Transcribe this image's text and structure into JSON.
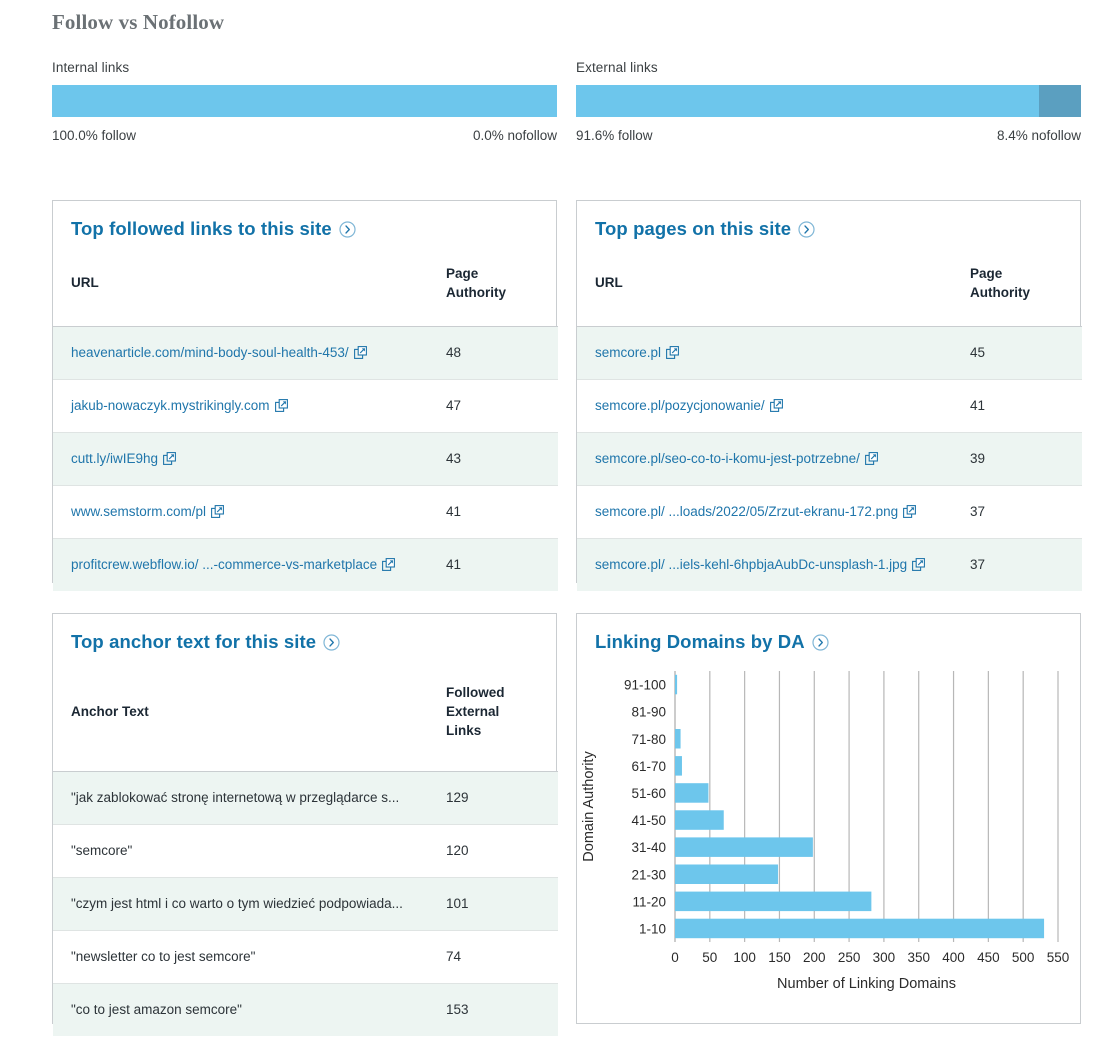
{
  "section": {
    "title": "Follow vs Nofollow"
  },
  "colors": {
    "follow_bar": "#6dc6ec",
    "nofollow_bar": "#5b9fc0",
    "card_title": "#1272a8",
    "link": "#2076ab",
    "chart_bar": "#6dc6ec",
    "row_stripe": "#edf5f2"
  },
  "follow_bars": {
    "internal": {
      "label": "Internal links",
      "follow_pct": 100.0,
      "nofollow_pct": 0.0,
      "follow_text": "100.0% follow",
      "nofollow_text": "0.0% nofollow"
    },
    "external": {
      "label": "External links",
      "follow_pct": 91.6,
      "nofollow_pct": 8.4,
      "follow_text": "91.6% follow",
      "nofollow_text": "8.4% nofollow"
    }
  },
  "cards": {
    "top_followed_links": {
      "title": "Top followed links to this site",
      "expand_icon": "chevron-right-circle-icon",
      "columns": [
        "URL",
        "Page\nAuthority"
      ],
      "col_url": "URL",
      "col_num": "Page Authority",
      "rows": [
        {
          "url": "heavenarticle.com/mind-body-soul-health-453/",
          "value": "48"
        },
        {
          "url": "jakub-nowaczyk.mystrikingly.com",
          "value": "47"
        },
        {
          "url": "cutt.ly/iwIE9hg",
          "value": "43"
        },
        {
          "url": "www.semstorm.com/pl",
          "value": "41"
        },
        {
          "url": "profitcrew.webflow.io/ ...-commerce-vs-marketplace",
          "value": "41"
        }
      ]
    },
    "top_pages": {
      "title": "Top pages on this site",
      "expand_icon": "chevron-right-circle-icon",
      "col_url": "URL",
      "col_num": "Page Authority",
      "rows": [
        {
          "url": "semcore.pl",
          "value": "45"
        },
        {
          "url": "semcore.pl/pozycjonowanie/",
          "value": "41"
        },
        {
          "url": "semcore.pl/seo-co-to-i-komu-jest-potrzebne/",
          "value": "39"
        },
        {
          "url": "semcore.pl/ ...loads/2022/05/Zrzut-ekranu-172.png",
          "value": "37"
        },
        {
          "url": "semcore.pl/ ...iels-kehl-6hpbjaAubDc-unsplash-1.jpg",
          "value": "37"
        }
      ]
    },
    "top_anchor_text": {
      "title": "Top anchor text for this site",
      "expand_icon": "chevron-right-circle-icon",
      "col_text": "Anchor Text",
      "col_num": "Followed External Links",
      "rows": [
        {
          "text": "\"jak zablokować stronę internetową w przeglądarce s...",
          "value": "129"
        },
        {
          "text": "\"semcore\"",
          "value": "120"
        },
        {
          "text": "\"czym jest html i co warto o tym wiedzieć podpowiada...",
          "value": "101"
        },
        {
          "text": "\"newsletter co to jest semcore\"",
          "value": "74"
        },
        {
          "text": "\"co to jest amazon semcore\"",
          "value": "153"
        }
      ]
    },
    "linking_domains": {
      "title": "Linking Domains by DA",
      "expand_icon": "chevron-right-circle-icon"
    }
  },
  "chart_data": {
    "type": "bar",
    "orientation": "horizontal",
    "title": "Linking Domains by DA",
    "xlabel": "Number of Linking Domains",
    "ylabel": "Domain Authority",
    "categories": [
      "91-100",
      "81-90",
      "71-80",
      "61-70",
      "51-60",
      "41-50",
      "31-40",
      "21-30",
      "11-20",
      "1-10"
    ],
    "values": [
      3,
      0,
      8,
      10,
      48,
      70,
      198,
      148,
      282,
      530
    ],
    "xlim": [
      0,
      550
    ],
    "xticks": [
      0,
      50,
      100,
      150,
      200,
      250,
      300,
      350,
      400,
      450,
      500,
      550
    ],
    "xtick_labels": [
      "0",
      "50",
      "100",
      "150",
      "200",
      "250",
      "300",
      "350",
      "400",
      "450",
      "500",
      "550"
    ],
    "grid": "vertical",
    "legend": "none",
    "bar_color": "#6dc6ec"
  }
}
